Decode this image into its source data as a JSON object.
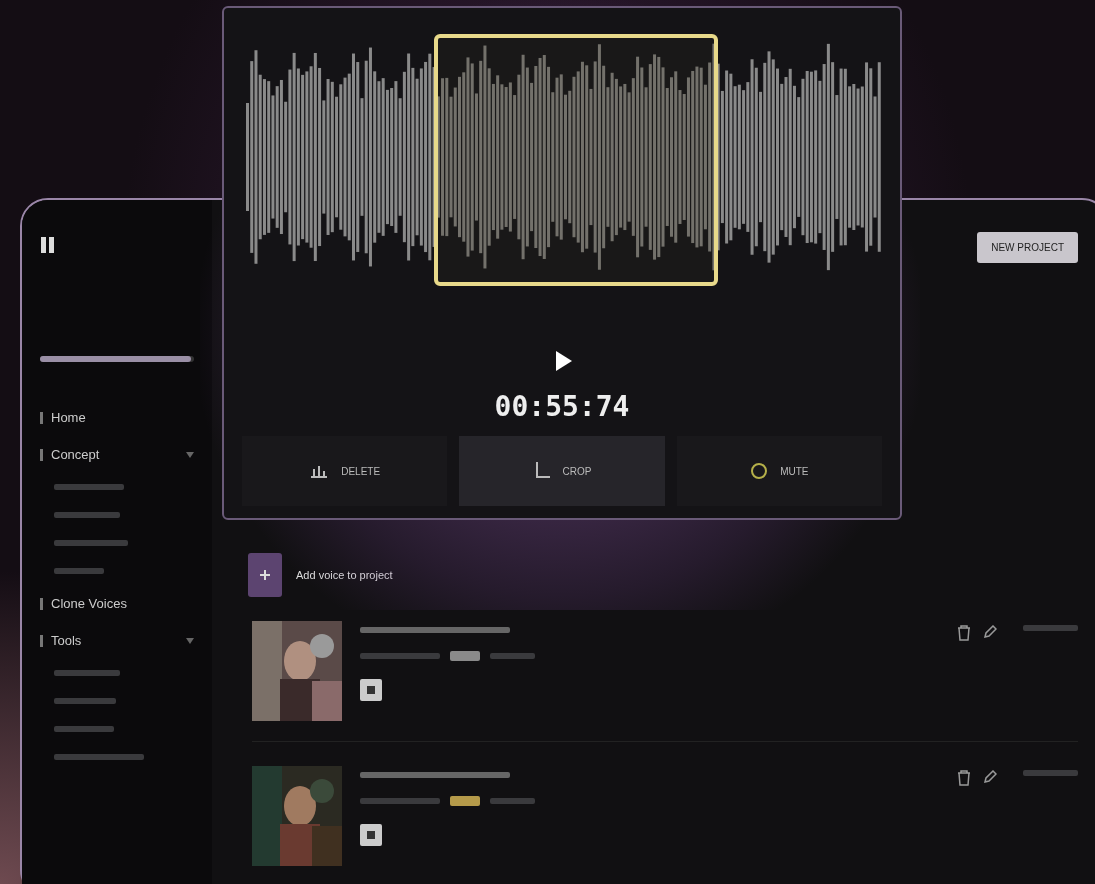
{
  "sidebar": {
    "usage": {
      "level": 0.98
    },
    "items": [
      {
        "label": "Home",
        "expanded": false
      },
      {
        "label": "Concept",
        "expanded": true
      },
      {
        "label": "Clone Voices",
        "expanded": false
      },
      {
        "label": "Tools",
        "expanded": true
      }
    ]
  },
  "header": {
    "new_project": "NEW PROJECT"
  },
  "add_voice": {
    "label": "Add voice to project"
  },
  "voices": [
    {
      "color": "#8a8a8a"
    },
    {
      "color": "#b59a4a"
    }
  ],
  "editor": {
    "timer": "00:55:74",
    "actions": [
      {
        "label": "DELETE",
        "kind": "delete",
        "selected": false
      },
      {
        "label": "CROP",
        "kind": "crop",
        "selected": true
      },
      {
        "label": "MUTE",
        "kind": "mute",
        "selected": false
      }
    ]
  }
}
